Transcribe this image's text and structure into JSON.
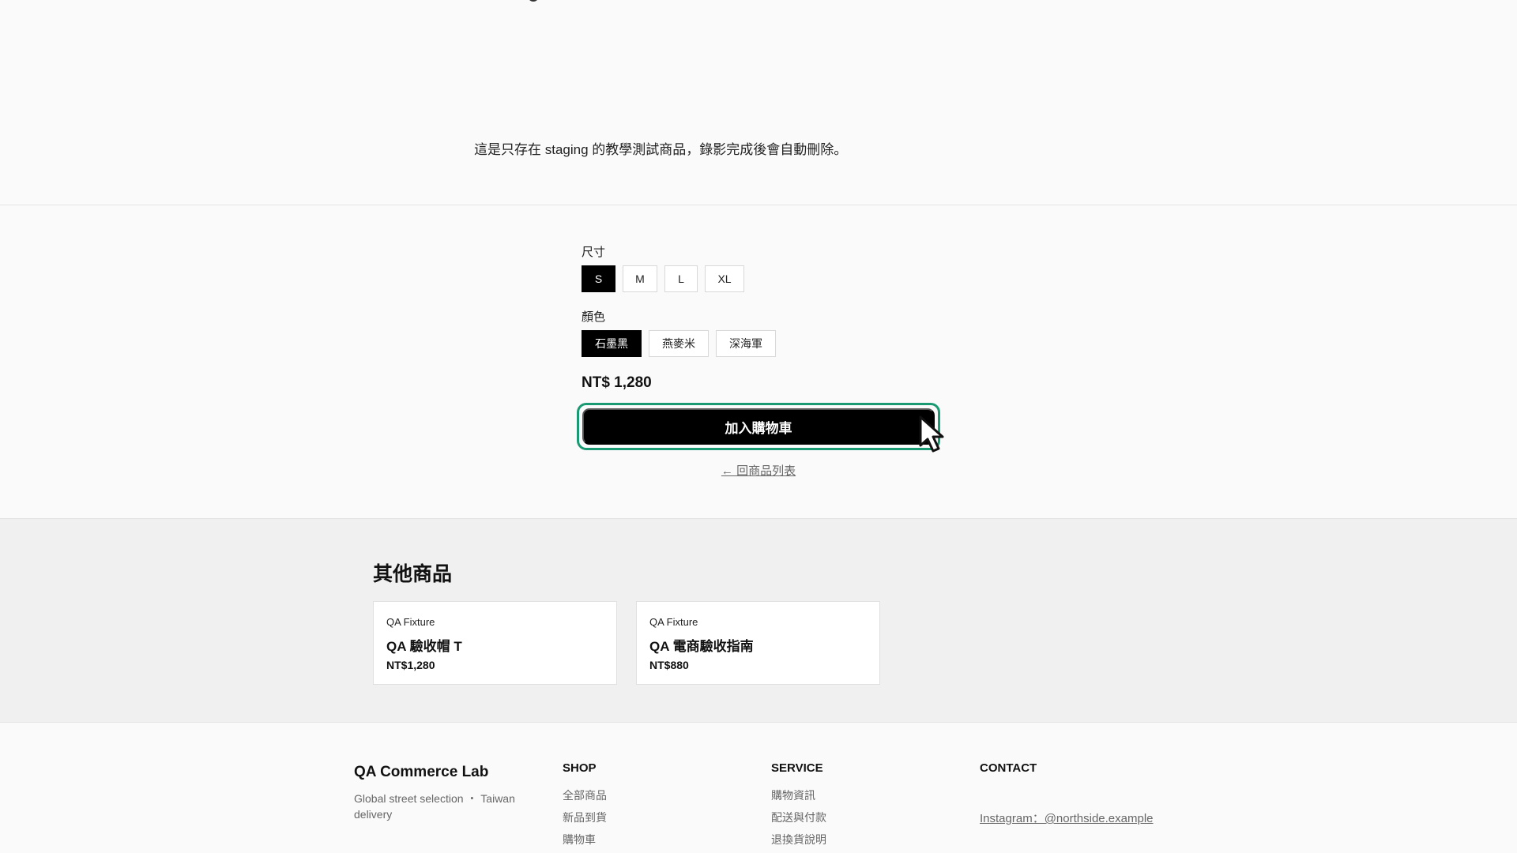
{
  "product": {
    "description": "這是只存在 staging 的教學測試商品，錄影完成後會自動刪除。",
    "size_label": "尺寸",
    "sizes": [
      "S",
      "M",
      "L",
      "XL"
    ],
    "selected_size": "S",
    "color_label": "顏色",
    "colors": [
      "石墨黑",
      "燕麥米",
      "深海軍"
    ],
    "selected_color": "石墨黑",
    "price": "NT$ 1,280",
    "add_to_cart_label": "加入購物車",
    "back_link": "← 回商品列表"
  },
  "other_products": {
    "title": "其他商品",
    "items": [
      {
        "brand": "QA Fixture",
        "name": "QA 驗收帽 T",
        "price": "NT$1,280"
      },
      {
        "brand": "QA Fixture",
        "name": "QA 電商驗收指南",
        "price": "NT$880"
      }
    ]
  },
  "footer": {
    "brand": "QA Commerce Lab",
    "tagline": "Global street selection ・ Taiwan delivery",
    "shop": {
      "heading": "SHOP",
      "links": [
        "全部商品",
        "新品到貨",
        "購物車"
      ]
    },
    "service": {
      "heading": "SERVICE",
      "links": [
        "購物資訊",
        "配送與付款",
        "退換貨說明"
      ]
    },
    "contact": {
      "heading": "CONTACT",
      "instagram": "Instagram：@northside.example"
    }
  },
  "colors": {
    "accent_outline": "#1a9a72",
    "selected_bg": "#000000"
  }
}
